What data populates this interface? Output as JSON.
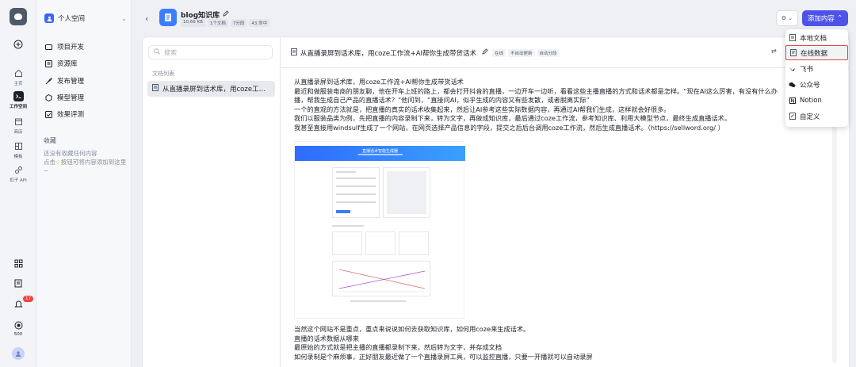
{
  "rail": {
    "items": [
      {
        "label": "主页"
      },
      {
        "label": "工作空间"
      },
      {
        "label": "商店"
      },
      {
        "label": "模板"
      },
      {
        "label": "扣子 API"
      }
    ],
    "notification_count": "17",
    "points": "500"
  },
  "space": {
    "name": "个人空间",
    "nav": [
      {
        "label": "项目开发"
      },
      {
        "label": "资源库"
      },
      {
        "label": "发布管理"
      },
      {
        "label": "模型管理"
      },
      {
        "label": "效果评测"
      }
    ],
    "favorites_title": "收藏",
    "favorites_empty": "还没有收藏任何内容",
    "favorites_hint_pre": "点击",
    "favorites_hint_post": "按钮可将内容添加到这里~"
  },
  "kb": {
    "title": "blog知识库",
    "tags": [
      "10.66 KB",
      "1个文档",
      "7分段",
      "43 命中"
    ],
    "add_button": "添加内容"
  },
  "doclist": {
    "search_placeholder": "搜索",
    "section_title": "文档列表",
    "items": [
      {
        "label": "从直播录屏到话术库，用coze工…"
      }
    ]
  },
  "doc": {
    "title": "从直播录屏到话术库，用coze工作流+AI帮你生成带货话术",
    "tags": [
      "在线",
      "不自动更新",
      "自动分段"
    ],
    "paragraphs_top": [
      "从直播录屏到话术库，用coze工作流+AI帮你生成带货话术",
      "最近和做服装电商的朋友聊，他在开车上班的路上，都会打开抖音的直播，一边开车一边听，看看这些主播直播的方式和话术都是怎样。“现在AI这么厉害，有没有什么办",
      "播，帮我生成自己产品的直播话术？”他问到，“直接问AI，似乎生成的内容又有些发散，或者脱离实际”",
      "一个的直观的方法就是，把直播的真实的话术收集起来，然后让AI参考这些实际数据内容，再通过AI帮我们生成，这样就会好很多。",
      "我们以服装品类为例，先把直播的内容录制下来，转为文字，再做成知识库，最后通过coze工作流，参考知识库、利用大模型节点，最终生成直播话术。",
      "我甚至直接用windsulf生成了一个网站，在网页选择产品信息的字段，提交之后后台调用coze工作流，然后生成直播话术。（https://sellword.org/ ）"
    ],
    "paragraphs_bottom": [
      "当然这个网站不是重点，重点来说说如何去获取知识库，如何用coze来生成话术。",
      "直播的话术数据从哪来",
      "最原始的方式就是把主播的直播都录制下来，然后转为文字，并存成文档",
      "如何录制是个麻烦事，正好朋友最近做了一个直播录屏工具，可以监控直播，只要一开播就可以自动录屏"
    ],
    "screenshot_title": "直播话术智能生成器"
  },
  "menu": {
    "items": [
      {
        "label": "本地文档"
      },
      {
        "label": "在线数据"
      },
      {
        "label": "飞书"
      },
      {
        "label": "公众号"
      },
      {
        "label": "Notion"
      },
      {
        "label": "自定义"
      }
    ]
  },
  "colors": {
    "accent": "#4d53e8",
    "highlight_border": "#e34545",
    "kb_icon": "#3c7dff"
  }
}
